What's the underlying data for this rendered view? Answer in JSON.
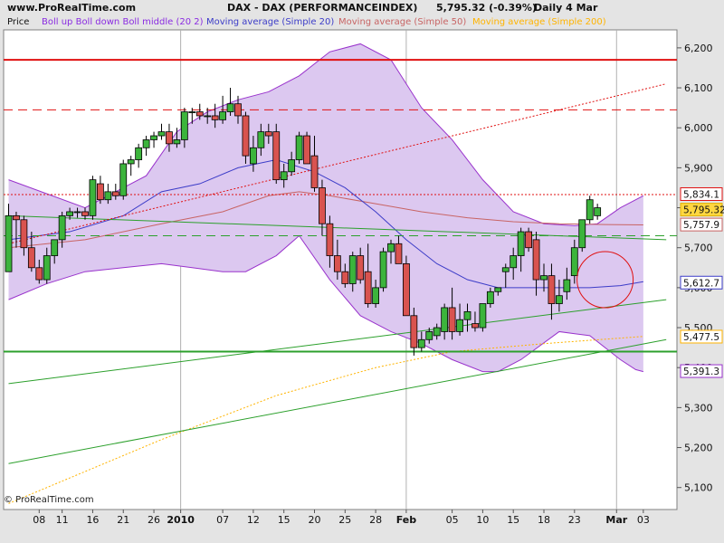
{
  "header": {
    "site": "www.ProRealTime.com",
    "title": "DAX - DAX (PERFORMANCEINDEX)",
    "price_change": "5,795.32 (-0.39%)",
    "period": "Daily  4 Mar"
  },
  "legend": {
    "price": "Price",
    "boll": "Boll up Boll down Boll middle (20 2)",
    "ma20": "Moving average (Simple 20)",
    "ma50": "Moving average (Simple 50)",
    "ma200": "Moving average (Simple 200)"
  },
  "watermark": "© ProRealTime.com",
  "colors": {
    "bull": "#3cb43c",
    "bear": "#d9534f",
    "band_fill": "#dcc8f0",
    "band_line": "#9932cc",
    "ma20": "#3c3cc8",
    "ma50": "#c86464",
    "ma200": "#ffb400",
    "support": "#2ca02c",
    "resistance": "#e01010"
  },
  "chart_data": {
    "type": "candlestick",
    "y_ticks": [
      "6,200",
      "6,100",
      "6,000",
      "5,900",
      "5,800",
      "5,700",
      "5,600",
      "5,500",
      "5,400",
      "5,300",
      "5,200",
      "5,100"
    ],
    "ylim": [
      5045,
      6245
    ],
    "x_labels": [
      "08",
      "11",
      "16",
      "21",
      "26",
      "2010",
      "07",
      "12",
      "15",
      "20",
      "25",
      "28",
      "Feb",
      "05",
      "10",
      "15",
      "18",
      "23",
      "Mar",
      "03"
    ],
    "x_label_sessions": [
      4,
      7,
      11,
      15,
      19,
      22.5,
      28,
      32,
      36,
      40,
      44,
      48,
      52,
      58,
      62,
      66,
      70,
      74,
      79.5,
      83
    ],
    "ohlc": [
      [
        5640,
        5810,
        5690,
        5780
      ],
      [
        5780,
        5790,
        5700,
        5770
      ],
      [
        5770,
        5780,
        5680,
        5700
      ],
      [
        5700,
        5740,
        5640,
        5650
      ],
      [
        5650,
        5670,
        5610,
        5620
      ],
      [
        5620,
        5700,
        5610,
        5680
      ],
      [
        5680,
        5720,
        5660,
        5720
      ],
      [
        5720,
        5790,
        5700,
        5780
      ],
      [
        5780,
        5800,
        5770,
        5790
      ],
      [
        5790,
        5800,
        5775,
        5790
      ],
      [
        5790,
        5800,
        5770,
        5780
      ],
      [
        5780,
        5880,
        5770,
        5870
      ],
      [
        5860,
        5880,
        5810,
        5820
      ],
      [
        5820,
        5860,
        5810,
        5840
      ],
      [
        5840,
        5860,
        5820,
        5830
      ],
      [
        5830,
        5920,
        5820,
        5910
      ],
      [
        5910,
        5930,
        5880,
        5920
      ],
      [
        5920,
        5960,
        5900,
        5950
      ],
      [
        5950,
        5980,
        5930,
        5970
      ],
      [
        5970,
        5990,
        5950,
        5980
      ],
      [
        5980,
        6010,
        5970,
        5990
      ],
      [
        5990,
        6010,
        5940,
        5960
      ],
      [
        5960,
        6000,
        5950,
        5970
      ],
      [
        5970,
        6050,
        5950,
        6040
      ],
      [
        6040,
        6050,
        6010,
        6040
      ],
      [
        6040,
        6060,
        6020,
        6030
      ],
      [
        6030,
        6050,
        6010,
        6030
      ],
      [
        6030,
        6060,
        6000,
        6020
      ],
      [
        6020,
        6080,
        6010,
        6040
      ],
      [
        6040,
        6100,
        6030,
        6060
      ],
      [
        6060,
        6080,
        6010,
        6030
      ],
      [
        6030,
        6040,
        5910,
        5930
      ],
      [
        5910,
        5980,
        5890,
        5950
      ],
      [
        5950,
        6010,
        5930,
        5990
      ],
      [
        5990,
        6010,
        5960,
        5980
      ],
      [
        5990,
        6010,
        5860,
        5870
      ],
      [
        5870,
        5910,
        5850,
        5890
      ],
      [
        5890,
        5940,
        5880,
        5920
      ],
      [
        5920,
        5990,
        5910,
        5980
      ],
      [
        5980,
        5990,
        5910,
        5910
      ],
      [
        5930,
        5980,
        5840,
        5850
      ],
      [
        5850,
        5870,
        5730,
        5760
      ],
      [
        5760,
        5780,
        5650,
        5680
      ],
      [
        5680,
        5720,
        5620,
        5640
      ],
      [
        5640,
        5660,
        5600,
        5610
      ],
      [
        5610,
        5690,
        5590,
        5680
      ],
      [
        5680,
        5700,
        5610,
        5620
      ],
      [
        5640,
        5710,
        5550,
        5560
      ],
      [
        5560,
        5620,
        5550,
        5600
      ],
      [
        5600,
        5700,
        5590,
        5690
      ],
      [
        5690,
        5720,
        5660,
        5710
      ],
      [
        5710,
        5730,
        5660,
        5660
      ],
      [
        5660,
        5680,
        5550,
        5530
      ],
      [
        5530,
        5550,
        5430,
        5450
      ],
      [
        5450,
        5490,
        5440,
        5470
      ],
      [
        5470,
        5500,
        5460,
        5490
      ],
      [
        5480,
        5510,
        5470,
        5500
      ],
      [
        5490,
        5560,
        5470,
        5550
      ],
      [
        5550,
        5600,
        5470,
        5490
      ],
      [
        5490,
        5560,
        5480,
        5520
      ],
      [
        5520,
        5560,
        5490,
        5540
      ],
      [
        5510,
        5540,
        5490,
        5500
      ],
      [
        5500,
        5560,
        5490,
        5560
      ],
      [
        5560,
        5600,
        5550,
        5590
      ],
      [
        5590,
        5600,
        5580,
        5600
      ],
      [
        5640,
        5660,
        5600,
        5650
      ],
      [
        5650,
        5700,
        5620,
        5680
      ],
      [
        5680,
        5750,
        5640,
        5740
      ],
      [
        5740,
        5750,
        5690,
        5700
      ],
      [
        5720,
        5740,
        5580,
        5620
      ],
      [
        5620,
        5660,
        5590,
        5630
      ],
      [
        5630,
        5660,
        5520,
        5560
      ],
      [
        5560,
        5620,
        5540,
        5580
      ],
      [
        5590,
        5650,
        5570,
        5620
      ],
      [
        5630,
        5720,
        5610,
        5700
      ],
      [
        5700,
        5770,
        5690,
        5770
      ],
      [
        5770,
        5830,
        5760,
        5820
      ],
      [
        5780,
        5810,
        5770,
        5800
      ]
    ],
    "bollinger_upper": [
      [
        0,
        5870
      ],
      [
        10,
        5800
      ],
      [
        18,
        5880
      ],
      [
        22,
        5990
      ],
      [
        26,
        6040
      ],
      [
        30,
        6070
      ],
      [
        34,
        6090
      ],
      [
        38,
        6130
      ],
      [
        42,
        6190
      ],
      [
        46,
        6210
      ],
      [
        50,
        6170
      ],
      [
        54,
        6050
      ],
      [
        58,
        5970
      ],
      [
        62,
        5870
      ],
      [
        66,
        5790
      ],
      [
        70,
        5760
      ],
      [
        74,
        5755
      ],
      [
        77,
        5760
      ],
      [
        80,
        5800
      ],
      [
        83,
        5830
      ]
    ],
    "bollinger_lower": [
      [
        0,
        5570
      ],
      [
        5,
        5610
      ],
      [
        10,
        5640
      ],
      [
        15,
        5650
      ],
      [
        20,
        5660
      ],
      [
        24,
        5650
      ],
      [
        28,
        5640
      ],
      [
        31,
        5640
      ],
      [
        35,
        5680
      ],
      [
        38,
        5730
      ],
      [
        42,
        5620
      ],
      [
        46,
        5530
      ],
      [
        50,
        5490
      ],
      [
        54,
        5460
      ],
      [
        58,
        5420
      ],
      [
        62,
        5390
      ],
      [
        64,
        5390
      ],
      [
        67,
        5420
      ],
      [
        72,
        5490
      ],
      [
        76,
        5480
      ],
      [
        80,
        5420
      ],
      [
        82,
        5395
      ],
      [
        83,
        5390
      ]
    ],
    "ma20": [
      [
        0,
        5720
      ],
      [
        8,
        5740
      ],
      [
        15,
        5780
      ],
      [
        20,
        5840
      ],
      [
        25,
        5860
      ],
      [
        30,
        5900
      ],
      [
        35,
        5920
      ],
      [
        40,
        5890
      ],
      [
        44,
        5850
      ],
      [
        48,
        5790
      ],
      [
        52,
        5720
      ],
      [
        56,
        5660
      ],
      [
        60,
        5620
      ],
      [
        64,
        5600
      ],
      [
        68,
        5600
      ],
      [
        72,
        5600
      ],
      [
        76,
        5600
      ],
      [
        80,
        5605
      ],
      [
        83,
        5615
      ]
    ],
    "ma50": [
      [
        0,
        5700
      ],
      [
        10,
        5720
      ],
      [
        20,
        5760
      ],
      [
        28,
        5790
      ],
      [
        34,
        5830
      ],
      [
        38,
        5840
      ],
      [
        42,
        5830
      ],
      [
        48,
        5810
      ],
      [
        54,
        5790
      ],
      [
        60,
        5775
      ],
      [
        66,
        5765
      ],
      [
        72,
        5760
      ],
      [
        78,
        5758
      ],
      [
        83,
        5757
      ]
    ],
    "ma200": [
      [
        0,
        5060
      ],
      [
        20,
        5220
      ],
      [
        35,
        5330
      ],
      [
        48,
        5400
      ],
      [
        58,
        5440
      ],
      [
        70,
        5460
      ],
      [
        83,
        5478
      ]
    ],
    "trend_lines": [
      {
        "kind": "support",
        "from": [
          0,
          5160
        ],
        "to": [
          86,
          5470
        ]
      },
      {
        "kind": "support",
        "from": [
          0,
          5360
        ],
        "to": [
          86,
          5570
        ]
      },
      {
        "kind": "support",
        "from": [
          0,
          5780
        ],
        "to": [
          86,
          5720
        ]
      },
      {
        "kind": "resistance",
        "from": [
          0,
          5710
        ],
        "to": [
          86,
          6110
        ]
      }
    ],
    "horizontal_lines": [
      {
        "y": 6170,
        "style": "solid",
        "kind": "resistance"
      },
      {
        "y": 6045,
        "style": "dashed",
        "kind": "resistance"
      },
      {
        "y": 5833,
        "style": "dotted",
        "kind": "resistance"
      },
      {
        "y": 5730,
        "style": "dashed",
        "kind": "support"
      },
      {
        "y": 5440,
        "style": "solid",
        "kind": "support"
      }
    ],
    "price_tags": [
      {
        "value": 5834.1,
        "label": "5,834.1"
      },
      {
        "value": 5795.32,
        "label": "5,795.32"
      },
      {
        "value": 5757.9,
        "label": "5,757.9"
      },
      {
        "value": 5612.7,
        "label": "5,612.7"
      },
      {
        "value": 5477.5,
        "label": "5,477.5"
      },
      {
        "value": 5391.3,
        "label": "5,391.3"
      }
    ],
    "annotation_circle": {
      "x": 78,
      "y": 5620
    }
  }
}
